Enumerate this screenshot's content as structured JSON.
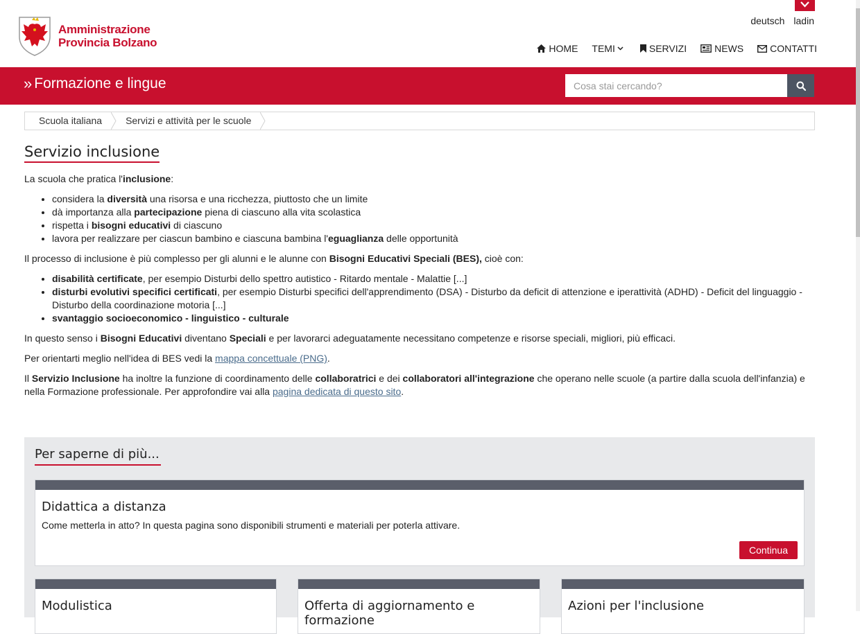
{
  "colors": {
    "brand_red": "#c8102e",
    "card_bar": "#5a5e6a",
    "search_button": "#4d5563",
    "link": "#4a6c8c"
  },
  "languages": [
    "deutsch",
    "ladin"
  ],
  "logo": {
    "line1": "Amministrazione",
    "line2": "Provincia Bolzano"
  },
  "nav": {
    "home": "HOME",
    "temi": "TEMI",
    "servizi": "SERVIZI",
    "news": "NEWS",
    "contatti": "CONTATTI"
  },
  "band": {
    "title": "Formazione e lingue",
    "search_placeholder": "Cosa stai cercando?"
  },
  "breadcrumb": [
    "Scuola italiana",
    "Servizi e attività per le scuole"
  ],
  "page": {
    "title": "Servizio inclusione",
    "intro_pre": "La scuola che pratica l'",
    "intro_bold": "inclusione",
    "intro_post": ":",
    "list1": [
      {
        "pre": "considera la ",
        "bold": "diversità",
        "post": " una risorsa e una ricchezza, piuttosto che un limite"
      },
      {
        "pre": "dà importanza alla ",
        "bold": "partecipazione",
        "post": " piena di ciascuno alla vita scolastica"
      },
      {
        "pre": "rispetta i ",
        "bold": "bisogni educativi",
        "post": " di ciascuno"
      },
      {
        "pre": "lavora per realizzare per ciascun bambino e ciascuna bambina l'",
        "bold": "eguaglianza",
        "post": " delle opportunità"
      }
    ],
    "process_pre": "Il processo di inclusione è più complesso per gli alunni e le alunne con ",
    "process_bold": "Bisogni Educativi Speciali (BES),",
    "process_post": " cioè con:",
    "list2": [
      {
        "bold": "disabilità certificate",
        "post": ", per esempio Disturbi dello spettro autistico - Ritardo mentale - Malattie [...]"
      },
      {
        "bold": "disturbi evolutivi specifici certificati",
        "post": ", per esempio Disturbi specifici dell'apprendimento (DSA) - Disturbo da deficit di attenzione e iperattività (ADHD) - Deficit del linguaggio - Disturbo della coordinazione motoria [...]"
      },
      {
        "bold": "svantaggio socioeconomico - linguistico - culturale",
        "post": ""
      }
    ],
    "sense_1": "In questo senso i ",
    "sense_b1": "Bisogni Educativi",
    "sense_2": " diventano ",
    "sense_b2": "Speciali",
    "sense_3": " e per lavorarci adeguatamente necessitano competenze e risorse speciali, migliori, più efficaci.",
    "orient_pre": "Per orientarti meglio nell'idea di BES vedi la ",
    "orient_link": "mappa concettuale (PNG)",
    "orient_post": ".",
    "serv_1": "Il ",
    "serv_b1": "Servizio Inclusione",
    "serv_2": " ha inoltre la funzione di coordinamento delle ",
    "serv_b2": "collaboratrici",
    "serv_3": " e dei ",
    "serv_b3": "collaboratori all'integrazione",
    "serv_4": " che operano nelle scuole (a partire dalla scuola dell'infanzia) e nella Formazione professionale. Per approfondire vai alla ",
    "serv_link": "pagina dedicata di questo sito",
    "serv_5": "."
  },
  "more": {
    "title": "Per saperne di più...",
    "featured": {
      "title": "Didattica a distanza",
      "text": "Come metterla in atto? In questa pagina sono disponibili strumenti e materiali per poterla attivare.",
      "button": "Continua"
    },
    "cards": [
      {
        "title": "Modulistica"
      },
      {
        "title": "Offerta di aggiornamento e formazione"
      },
      {
        "title": "Azioni per l'inclusione"
      }
    ]
  }
}
